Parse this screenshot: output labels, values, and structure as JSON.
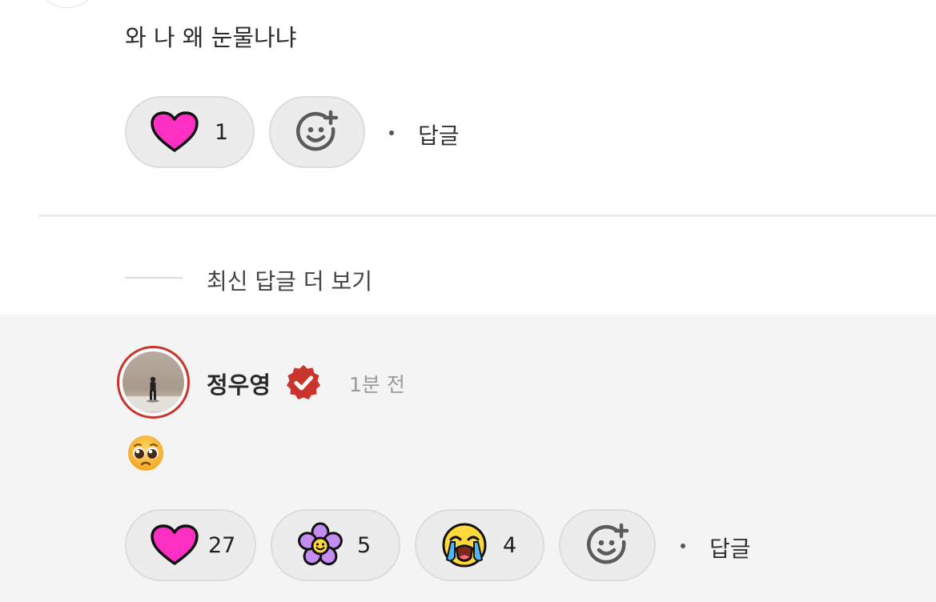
{
  "top_comment": {
    "text": "와 나 왜 눈물나냐",
    "reactions": [
      {
        "icon": "pink-heart-icon",
        "count": "1"
      }
    ],
    "add_reaction_icon": "add-reaction-icon",
    "reply_label": "답글"
  },
  "more_replies_label": "최신 답글 더 보기",
  "reply": {
    "username": "정우영",
    "verified_icon": "verified-badge-icon",
    "time": "1분 전",
    "content_emoji": "pleading-face-emoji",
    "reactions": [
      {
        "icon": "pink-heart-icon",
        "count": "27"
      },
      {
        "icon": "purple-flower-icon",
        "count": "5"
      },
      {
        "icon": "crying-face-icon",
        "count": "4"
      }
    ],
    "add_reaction_icon": "add-reaction-icon",
    "reply_label": "답글"
  },
  "colors": {
    "heart": "#ff2fc4",
    "verified": "#c9342d",
    "reply_bg": "#f4f4f4",
    "pill_bg": "#ececec"
  }
}
